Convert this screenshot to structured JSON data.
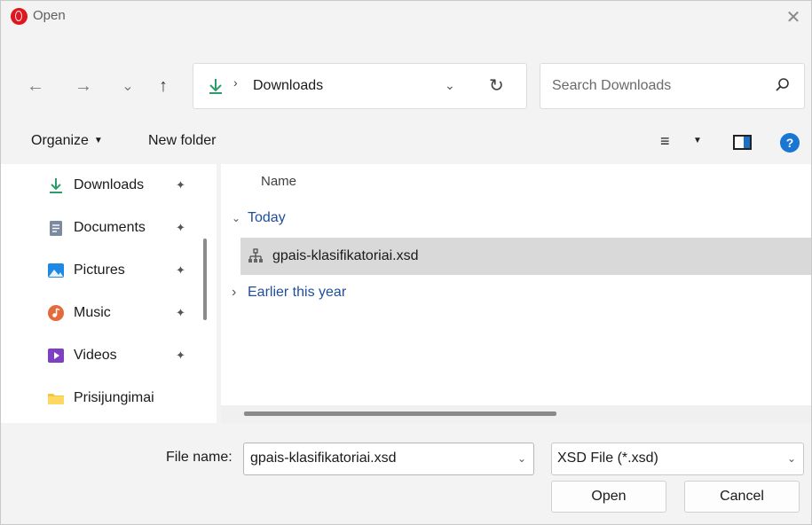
{
  "window": {
    "title": "Open",
    "close_glyph": "✕"
  },
  "nav": {
    "back_glyph": "←",
    "forward_glyph": "→",
    "recent_glyph": "⌄",
    "up_glyph": "↑"
  },
  "address": {
    "separator": "›",
    "location": "Downloads",
    "dropdown_glyph": "⌄",
    "refresh_glyph": "↻"
  },
  "search": {
    "placeholder": "Search Downloads"
  },
  "toolbar": {
    "organize_label": "Organize",
    "organize_caret": "▼",
    "new_folder_label": "New folder",
    "view_glyph": "≡",
    "view_caret": "▼",
    "help_glyph": "?"
  },
  "sidebar": {
    "items": [
      {
        "label": "Downloads",
        "icon": "download-icon",
        "pinned": true
      },
      {
        "label": "Documents",
        "icon": "documents-icon",
        "pinned": true
      },
      {
        "label": "Pictures",
        "icon": "pictures-icon",
        "pinned": true
      },
      {
        "label": "Music",
        "icon": "music-icon",
        "pinned": true
      },
      {
        "label": "Videos",
        "icon": "videos-icon",
        "pinned": true
      },
      {
        "label": "Prisijungimai",
        "icon": "folder-icon",
        "pinned": false
      }
    ],
    "pin_glyph": "📌"
  },
  "content": {
    "column_name": "Name",
    "groups": [
      {
        "label": "Today",
        "expanded": true,
        "chevron": "⌄"
      },
      {
        "label": "Earlier this year",
        "expanded": false,
        "chevron": "›"
      }
    ],
    "files": [
      {
        "name": "gpais-klasifikatoriai.xsd",
        "selected": true,
        "icon": "xsd-file-icon"
      }
    ]
  },
  "footer": {
    "file_name_label": "File name:",
    "file_name_value": "gpais-klasifikatoriai.xsd",
    "file_type_value": "XSD File (*.xsd)",
    "dropdown_glyph": "⌄",
    "open_label": "Open",
    "cancel_label": "Cancel"
  },
  "colors": {
    "accent": "#1976d2",
    "group_header": "#1f4e9a",
    "selection": "#d9d9d9",
    "download_icon": "#2e9c6a",
    "app_logo": "#e0161e"
  }
}
